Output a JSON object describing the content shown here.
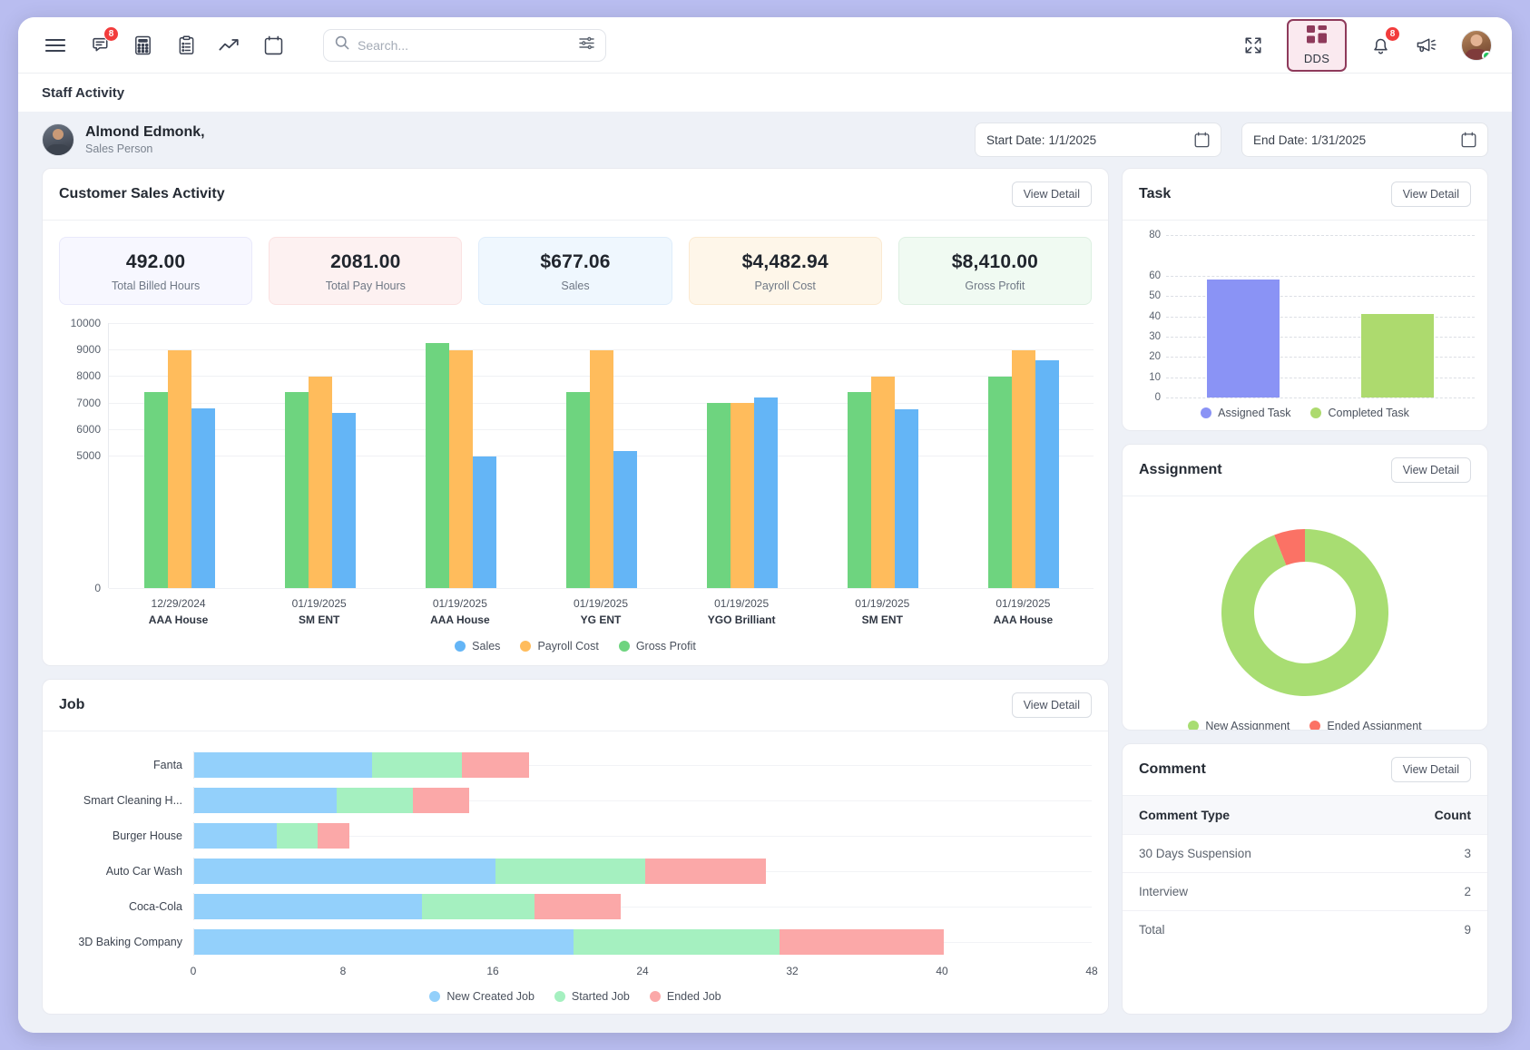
{
  "topbar": {
    "menu_icon": "hamburger-menu-icon",
    "chat_icon": "chat-bubble-icon",
    "chat_badge": "8",
    "calculator_icon": "calculator-icon",
    "clipboard_icon": "clipboard-list-icon",
    "trend_icon": "trending-up-icon",
    "calendar_icon": "calendar-icon",
    "search_placeholder": "Search...",
    "search_value": "",
    "search_icon": "search-icon",
    "filter_icon": "filter-sliders-icon",
    "expand_icon": "fullscreen-expand-icon",
    "dds_label": "DDS",
    "dds_icon": "grid-apps-icon",
    "bell_icon": "bell-notification-icon",
    "bell_badge": "8",
    "megaphone_icon": "megaphone-announcement-icon",
    "avatar_name": "user-avatar"
  },
  "page": {
    "title": "Staff Activity"
  },
  "profile": {
    "name": "Almond Edmonk,",
    "role": "Sales Person",
    "start_date_label": "Start Date:",
    "start_date_value": "1/1/2025",
    "end_date_label": "End Date:",
    "end_date_value": "1/31/2025",
    "calendar_icon": "calendar-icon"
  },
  "common": {
    "view_detail": "View Detail"
  },
  "sales_card": {
    "title": "Customer Sales Activity",
    "kpis": [
      {
        "value": "492.00",
        "label": "Total Billed Hours",
        "bg": "#f7f7ff",
        "border": "#e9e9fb"
      },
      {
        "value": "2081.00",
        "label": "Total Pay Hours",
        "bg": "#fdf1f1",
        "border": "#fbe2e2"
      },
      {
        "value": "$677.06",
        "label": "Sales",
        "bg": "#eff7fe",
        "border": "#dfedfb"
      },
      {
        "value": "$4,482.94",
        "label": "Payroll Cost",
        "bg": "#fef6e9",
        "border": "#fbead2"
      },
      {
        "value": "$8,410.00",
        "label": "Gross Profit",
        "bg": "#f0faf2",
        "border": "#ddf0e2"
      }
    ]
  },
  "chart_data": [
    {
      "id": "customer-sales-activity",
      "type": "bar",
      "title": "Customer Sales Activity",
      "xlabel": "",
      "ylabel": "",
      "ylim": [
        0,
        10000
      ],
      "yticks": [
        0,
        5000,
        6000,
        7000,
        8000,
        9000,
        10000
      ],
      "grid": true,
      "legend_position": "bottom",
      "categories": [
        {
          "date": "12/29/2024",
          "name": "AAA House"
        },
        {
          "date": "01/19/2025",
          "name": "SM ENT"
        },
        {
          "date": "01/19/2025",
          "name": "AAA House"
        },
        {
          "date": "01/19/2025",
          "name": "YG ENT"
        },
        {
          "date": "01/19/2025",
          "name": "YGO Brilliant"
        },
        {
          "date": "01/19/2025",
          "name": "SM ENT"
        },
        {
          "date": "01/19/2025",
          "name": "AAA House"
        }
      ],
      "series": [
        {
          "name": "Gross Profit",
          "color": "#6ed47f",
          "values": [
            7400,
            7400,
            9250,
            7400,
            6980,
            7400,
            7980
          ]
        },
        {
          "name": "Payroll Cost",
          "color": "#ffbc5c",
          "values": [
            8980,
            7980,
            8980,
            8980,
            6980,
            7980,
            8980
          ]
        },
        {
          "name": "Sales",
          "color": "#64b5f6",
          "values": [
            6770,
            6620,
            4980,
            5180,
            7200,
            6740,
            8600
          ]
        }
      ],
      "legend": [
        {
          "label": "Sales",
          "color": "#64b5f6"
        },
        {
          "label": "Payroll Cost",
          "color": "#ffbc5c"
        },
        {
          "label": "Gross Profit",
          "color": "#6ed47f"
        }
      ]
    },
    {
      "id": "job-stacked",
      "type": "bar",
      "orientation": "horizontal",
      "stacked": true,
      "title": "Job",
      "xlabel": "",
      "ylabel": "",
      "xlim": [
        0,
        48
      ],
      "xticks": [
        0,
        8,
        16,
        24,
        32,
        40,
        48
      ],
      "grid": true,
      "legend_position": "bottom",
      "categories": [
        "Fanta",
        "Smart Cleaning H...",
        "Burger House",
        "Auto Car Wash",
        "Coca-Cola",
        "3D Baking Company"
      ],
      "series": [
        {
          "name": "New Created Job",
          "color": "#93d0fb",
          "values": [
            9.5,
            7.6,
            4.4,
            16.1,
            12.2,
            20.3
          ]
        },
        {
          "name": "Started Job",
          "color": "#a5f0c0",
          "values": [
            4.8,
            4.1,
            2.2,
            8.0,
            6.0,
            11.0
          ]
        },
        {
          "name": "Ended Job",
          "color": "#fba8a8",
          "values": [
            3.6,
            3.0,
            1.7,
            6.5,
            4.6,
            8.8
          ]
        }
      ],
      "legend": [
        {
          "label": "New Created Job",
          "color": "#93d0fb"
        },
        {
          "label": "Started Job",
          "color": "#a5f0c0"
        },
        {
          "label": "Ended Job",
          "color": "#fba8a8"
        }
      ]
    },
    {
      "id": "task",
      "type": "bar",
      "title": "Task",
      "xlabel": "",
      "ylabel": "",
      "ylim": [
        0,
        80
      ],
      "yticks": [
        0,
        10,
        20,
        30,
        40,
        50,
        60,
        80
      ],
      "grid": true,
      "legend_position": "bottom",
      "categories": [
        "Assigned Task",
        "Completed Task"
      ],
      "values": [
        58,
        41
      ],
      "colors": [
        "#8a93f5",
        "#adda6e"
      ],
      "legend": [
        {
          "label": "Assigned Task",
          "color": "#8a93f5"
        },
        {
          "label": "Completed Task",
          "color": "#adda6e"
        }
      ]
    },
    {
      "id": "assignment",
      "type": "pie",
      "variant": "donut",
      "title": "Assignment",
      "legend_position": "bottom",
      "labels": [
        "New Assignment",
        "Ended Assignment"
      ],
      "values": [
        94,
        6
      ],
      "colors": [
        "#a8dd72",
        "#fb7265"
      ],
      "legend": [
        {
          "label": "New Assignment",
          "color": "#a8dd72"
        },
        {
          "label": "Ended Assignment",
          "color": "#fb7265"
        }
      ]
    }
  ],
  "job_card": {
    "title": "Job"
  },
  "task_card": {
    "title": "Task"
  },
  "assignment_card": {
    "title": "Assignment"
  },
  "comment_card": {
    "title": "Comment",
    "columns": [
      "Comment Type",
      "Count"
    ],
    "rows": [
      {
        "type": "30 Days Suspension",
        "count": "3"
      },
      {
        "type": "Interview",
        "count": "2"
      },
      {
        "type": "Total",
        "count": "9"
      }
    ]
  }
}
